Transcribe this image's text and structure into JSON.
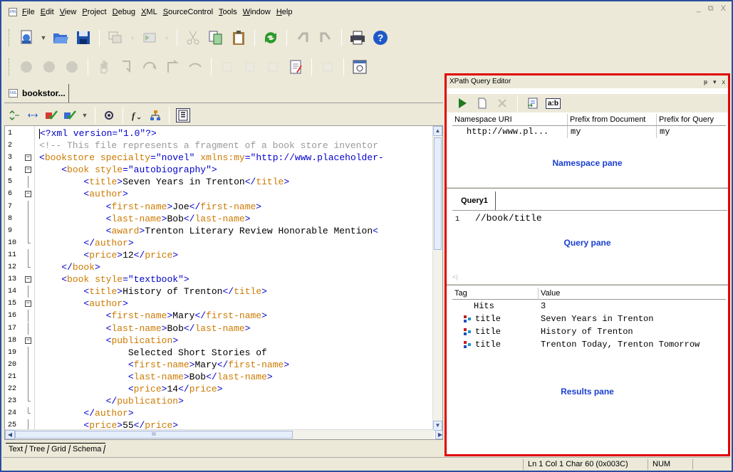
{
  "menu": {
    "items": [
      "File",
      "Edit",
      "View",
      "Project",
      "Debug",
      "XML",
      "SourceControl",
      "Tools",
      "Window",
      "Help"
    ],
    "window_controls": [
      "_",
      "⧉",
      "X"
    ]
  },
  "document_tab": {
    "label": "bookstor..."
  },
  "editor": {
    "lines": [
      {
        "n": "1",
        "fold": "",
        "html": "<span class='c-br'>&lt;?xml version=\"1.0\"?&gt;</span>"
      },
      {
        "n": "2",
        "fold": "",
        "html": "<span class='c-com'>&lt;!-- This file represents a fragment of a book store inventor</span>"
      },
      {
        "n": "3",
        "fold": "box",
        "html": "<span class='c-br'>&lt;</span><span class='c-tag'>bookstore</span> <span class='c-attr'>specialty</span><span class='c-br'>=\"novel\"</span> <span class='c-attr'>xmlns:my</span><span class='c-br'>=\"http://www.placeholder-</span>"
      },
      {
        "n": "4",
        "fold": "box",
        "html": "    <span class='c-br'>&lt;</span><span class='c-tag'>book</span> <span class='c-attr'>style</span><span class='c-br'>=\"autobiography\"&gt;</span>"
      },
      {
        "n": "5",
        "fold": "line",
        "html": "        <span class='c-br'>&lt;</span><span class='c-tag'>title</span><span class='c-br'>&gt;</span>Seven Years in Trenton<span class='c-br'>&lt;/</span><span class='c-tag'>title</span><span class='c-br'>&gt;</span>"
      },
      {
        "n": "6",
        "fold": "box",
        "html": "        <span class='c-br'>&lt;</span><span class='c-tag'>author</span><span class='c-br'>&gt;</span>"
      },
      {
        "n": "7",
        "fold": "line",
        "html": "            <span class='c-br'>&lt;</span><span class='c-tag'>first-name</span><span class='c-br'>&gt;</span>Joe<span class='c-br'>&lt;/</span><span class='c-tag'>first-name</span><span class='c-br'>&gt;</span>"
      },
      {
        "n": "8",
        "fold": "line",
        "html": "            <span class='c-br'>&lt;</span><span class='c-tag'>last-name</span><span class='c-br'>&gt;</span>Bob<span class='c-br'>&lt;/</span><span class='c-tag'>last-name</span><span class='c-br'>&gt;</span>"
      },
      {
        "n": "9",
        "fold": "line",
        "html": "            <span class='c-br'>&lt;</span><span class='c-tag'>award</span><span class='c-br'>&gt;</span>Trenton Literary Review Honorable Mention<span class='c-br'>&lt;</span>"
      },
      {
        "n": "10",
        "fold": "end",
        "html": "        <span class='c-br'>&lt;/</span><span class='c-tag'>author</span><span class='c-br'>&gt;</span>"
      },
      {
        "n": "11",
        "fold": "line",
        "html": "        <span class='c-br'>&lt;</span><span class='c-tag'>price</span><span class='c-br'>&gt;</span>12<span class='c-br'>&lt;/</span><span class='c-tag'>price</span><span class='c-br'>&gt;</span>"
      },
      {
        "n": "12",
        "fold": "end",
        "html": "    <span class='c-br'>&lt;/</span><span class='c-tag'>book</span><span class='c-br'>&gt;</span>"
      },
      {
        "n": "13",
        "fold": "box",
        "html": "    <span class='c-br'>&lt;</span><span class='c-tag'>book</span> <span class='c-attr'>style</span><span class='c-br'>=\"textbook\"&gt;</span>"
      },
      {
        "n": "14",
        "fold": "line",
        "html": "        <span class='c-br'>&lt;</span><span class='c-tag'>title</span><span class='c-br'>&gt;</span>History of Trenton<span class='c-br'>&lt;/</span><span class='c-tag'>title</span><span class='c-br'>&gt;</span>"
      },
      {
        "n": "15",
        "fold": "box",
        "html": "        <span class='c-br'>&lt;</span><span class='c-tag'>author</span><span class='c-br'>&gt;</span>"
      },
      {
        "n": "16",
        "fold": "line",
        "html": "            <span class='c-br'>&lt;</span><span class='c-tag'>first-name</span><span class='c-br'>&gt;</span>Mary<span class='c-br'>&lt;/</span><span class='c-tag'>first-name</span><span class='c-br'>&gt;</span>"
      },
      {
        "n": "17",
        "fold": "line",
        "html": "            <span class='c-br'>&lt;</span><span class='c-tag'>last-name</span><span class='c-br'>&gt;</span>Bob<span class='c-br'>&lt;/</span><span class='c-tag'>last-name</span><span class='c-br'>&gt;</span>"
      },
      {
        "n": "18",
        "fold": "box",
        "html": "            <span class='c-br'>&lt;</span><span class='c-tag'>publication</span><span class='c-br'>&gt;</span>"
      },
      {
        "n": "19",
        "fold": "line",
        "html": "                Selected Short Stories of"
      },
      {
        "n": "20",
        "fold": "line",
        "html": "                <span class='c-br'>&lt;</span><span class='c-tag'>first-name</span><span class='c-br'>&gt;</span>Mary<span class='c-br'>&lt;/</span><span class='c-tag'>first-name</span><span class='c-br'>&gt;</span>"
      },
      {
        "n": "21",
        "fold": "line",
        "html": "                <span class='c-br'>&lt;</span><span class='c-tag'>last-name</span><span class='c-br'>&gt;</span>Bob<span class='c-br'>&lt;/</span><span class='c-tag'>last-name</span><span class='c-br'>&gt;</span>"
      },
      {
        "n": "22",
        "fold": "line",
        "html": "                <span class='c-br'>&lt;</span><span class='c-tag'>price</span><span class='c-br'>&gt;</span>14<span class='c-br'>&lt;/</span><span class='c-tag'>price</span><span class='c-br'>&gt;</span>"
      },
      {
        "n": "23",
        "fold": "end",
        "html": "            <span class='c-br'>&lt;/</span><span class='c-tag'>publication</span><span class='c-br'>&gt;</span>"
      },
      {
        "n": "24",
        "fold": "end",
        "html": "        <span class='c-br'>&lt;/</span><span class='c-tag'>author</span><span class='c-br'>&gt;</span>"
      },
      {
        "n": "25",
        "fold": "line",
        "html": "        <span class='c-br'>&lt;</span><span class='c-tag'>price</span><span class='c-br'>&gt;</span>55<span class='c-br'>&lt;/</span><span class='c-tag'>price</span><span class='c-br'>&gt;</span>"
      }
    ]
  },
  "view_tabs": [
    "Text",
    "Tree",
    "Grid",
    "Schema"
  ],
  "status": {
    "position": "Ln 1 Col 1  Char 60 (0x003C)",
    "num": "NUM"
  },
  "xpath_editor": {
    "title": "XPath Query Editor",
    "title_controls": [
      "ᵽ",
      "▾",
      "x"
    ],
    "ab_button": "a:b",
    "namespace_headers": [
      "Namespace URI",
      "Prefix from Document",
      "Prefix for Query"
    ],
    "namespace_rows": [
      [
        "http://www.pl...",
        "my",
        "my"
      ]
    ],
    "namespace_pane_label": "Namespace pane",
    "query_tab": "Query1",
    "query_line_number": "1",
    "query_text": "//book/title",
    "query_pane_label": "Query pane",
    "results_headers": [
      "Tag",
      "Value"
    ],
    "hits_label": "Hits",
    "hits_value": "3",
    "results": [
      {
        "tag": "title",
        "value": "Seven Years in Trenton"
      },
      {
        "tag": "title",
        "value": "History of Trenton"
      },
      {
        "tag": "title",
        "value": "Trenton Today, Trenton Tomorrow"
      }
    ],
    "results_pane_label": "Results pane"
  },
  "colors": {
    "highlight_border": "#e00000",
    "pane_label": "#1a3fcf",
    "xml_tag": "#cc7a00",
    "xml_bracket": "#0000cc"
  }
}
